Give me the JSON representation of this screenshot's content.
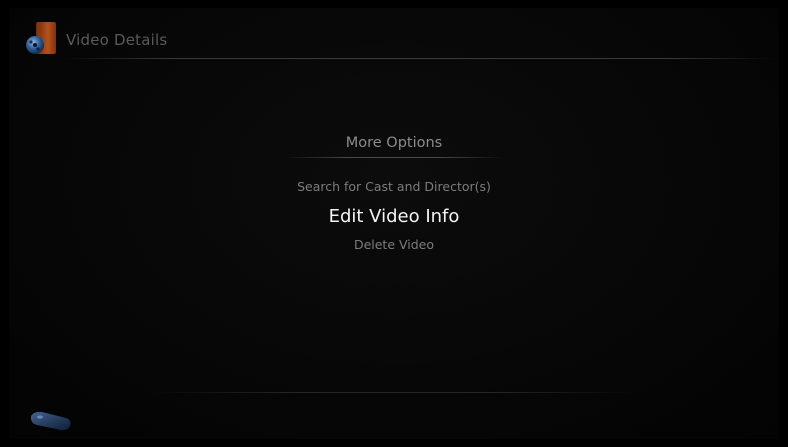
{
  "header": {
    "title": "Video Details",
    "icon": "film-reel-icon"
  },
  "menu": {
    "title": "More Options",
    "items": [
      {
        "label": "Search for Cast and Director(s)",
        "selected": false
      },
      {
        "label": "Edit Video Info",
        "selected": true
      },
      {
        "label": "Delete Video",
        "selected": false
      }
    ]
  },
  "footer": {
    "icon": "remote-control-icon"
  },
  "colors": {
    "background": "#050505",
    "header_text": "#5a5a5a",
    "menu_title": "#8c8c8c",
    "item_text": "#7c7c7c",
    "item_selected": "#f4f4f4",
    "icon_orange": "#b5521c",
    "icon_blue": "#2f5f9a"
  }
}
